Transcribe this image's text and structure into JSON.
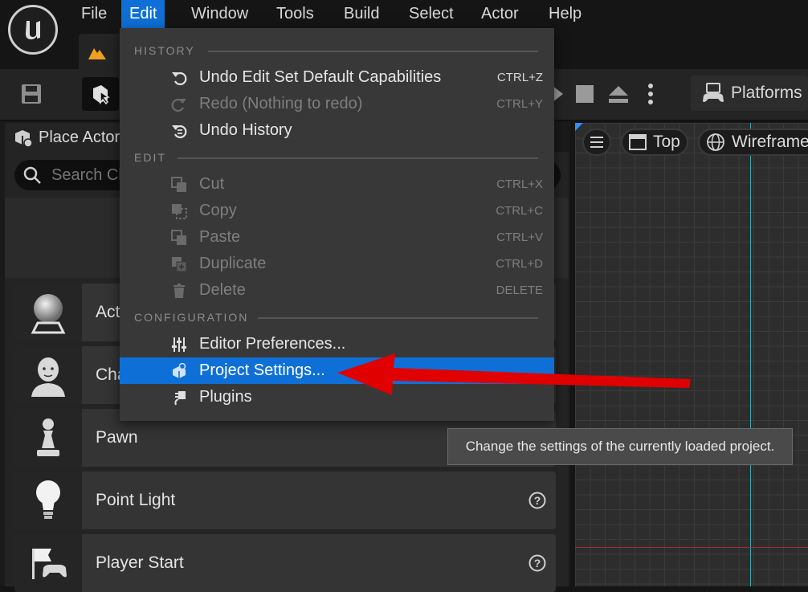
{
  "menubar": {
    "items": [
      "File",
      "Edit",
      "Window",
      "Tools",
      "Build",
      "Select",
      "Actor",
      "Help"
    ],
    "active": "Edit"
  },
  "toolbar": {
    "platforms_label": "Platforms"
  },
  "place_actors": {
    "tab_label": "Place Actor",
    "search_placeholder": "Search Cla",
    "items": [
      {
        "label": "Act",
        "icon": "sphere-actor-icon"
      },
      {
        "label": "Cha",
        "icon": "character-head-icon"
      },
      {
        "label": "Pawn",
        "icon": "pawn-icon"
      },
      {
        "label": "Point Light",
        "icon": "light-bulb-icon"
      },
      {
        "label": "Player Start",
        "icon": "player-start-flag-icon"
      }
    ]
  },
  "viewport": {
    "view_label": "Top",
    "mode_label": "Wireframe"
  },
  "edit_menu": {
    "sections": [
      {
        "title": "HISTORY",
        "items": [
          {
            "label": "Undo Edit Set Default Capabilities",
            "shortcut": "CTRL+Z",
            "enabled": true,
            "icon": "undo-icon"
          },
          {
            "label": "Redo (Nothing to redo)",
            "shortcut": "CTRL+Y",
            "enabled": false,
            "icon": "redo-icon"
          },
          {
            "label": "Undo History",
            "shortcut": "",
            "enabled": true,
            "icon": "undo-history-icon"
          }
        ]
      },
      {
        "title": "EDIT",
        "items": [
          {
            "label": "Cut",
            "shortcut": "CTRL+X",
            "enabled": false,
            "icon": "cut-icon"
          },
          {
            "label": "Copy",
            "shortcut": "CTRL+C",
            "enabled": false,
            "icon": "copy-icon"
          },
          {
            "label": "Paste",
            "shortcut": "CTRL+V",
            "enabled": false,
            "icon": "paste-icon"
          },
          {
            "label": "Duplicate",
            "shortcut": "CTRL+D",
            "enabled": false,
            "icon": "duplicate-icon"
          },
          {
            "label": "Delete",
            "shortcut": "DELETE",
            "enabled": false,
            "icon": "trash-icon"
          }
        ]
      },
      {
        "title": "CONFIGURATION",
        "items": [
          {
            "label": "Editor Preferences...",
            "shortcut": "",
            "enabled": true,
            "icon": "sliders-icon"
          },
          {
            "label": "Project Settings...",
            "shortcut": "",
            "enabled": true,
            "icon": "project-settings-icon",
            "highlighted": true
          },
          {
            "label": "Plugins",
            "shortcut": "",
            "enabled": true,
            "icon": "plugin-icon"
          }
        ]
      }
    ]
  },
  "tooltip": {
    "text": "Change the settings of the currently loaded project."
  },
  "colors": {
    "accent": "#0e70d6",
    "annotation_arrow": "#e00000"
  }
}
